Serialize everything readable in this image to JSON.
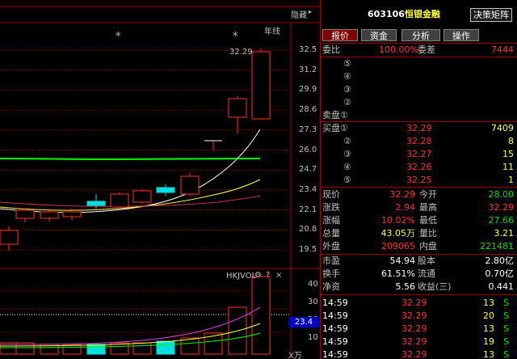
{
  "chart": {
    "hide_label": "隐藏",
    "period_label": "年线",
    "price_ticks": [
      "32.5",
      "31.2",
      "29.9",
      "28.6",
      "27.3",
      "26.0",
      "24.7",
      "23.4",
      "22.1",
      "20.8",
      "19.5"
    ],
    "high_label": "32.29",
    "star_marks": [
      "*",
      "*"
    ],
    "indicator_name": "HKJVOL",
    "indicator_tools": [
      "⚙",
      "?",
      "×"
    ],
    "vol_ticks": [
      "40",
      "30",
      "20",
      "10"
    ],
    "vol_current": "23.4",
    "vol_unit": "X万"
  },
  "header": {
    "code": "603106",
    "name": "恒银金融",
    "button": "决策矩阵"
  },
  "tabs": [
    "报价",
    "资金",
    "分析",
    "操作"
  ],
  "commission": {
    "ratio_label": "委比",
    "ratio_value": "100.00%",
    "diff_label": "委差",
    "diff_value": "7444"
  },
  "sell_levels": [
    {
      "label": "⑤",
      "price": "",
      "vol": ""
    },
    {
      "label": "④",
      "price": "",
      "vol": ""
    },
    {
      "label": "③",
      "price": "",
      "vol": ""
    },
    {
      "label": "②",
      "price": "",
      "vol": ""
    },
    {
      "label": "卖盘①",
      "price": "",
      "vol": ""
    }
  ],
  "buy_levels": [
    {
      "label": "买盘①",
      "price": "32.29",
      "vol": "7409"
    },
    {
      "label": "②",
      "price": "32.28",
      "vol": "8"
    },
    {
      "label": "③",
      "price": "32.27",
      "vol": "15"
    },
    {
      "label": "④",
      "price": "32.26",
      "vol": "11"
    },
    {
      "label": "⑤",
      "price": "32.25",
      "vol": "1"
    }
  ],
  "stats": [
    {
      "l1": "现价",
      "v1": "32.29",
      "l2": "今开",
      "v2": "28.00"
    },
    {
      "l1": "涨跌",
      "v1": "2.94",
      "l2": "最高",
      "v2": "32.29"
    },
    {
      "l1": "涨幅",
      "v1": "10.02%",
      "l2": "最低",
      "v2": "27.66"
    },
    {
      "l1": "总量",
      "v1": "43.05万",
      "l2": "量比",
      "v2": "3.21"
    },
    {
      "l1": "外盘",
      "v1": "209065",
      "l2": "内盘",
      "v2": "221481"
    }
  ],
  "fund": [
    {
      "l1": "市盈",
      "v1": "54.94",
      "l2": "股本",
      "v2": "2.80亿"
    },
    {
      "l1": "换手",
      "v1": "61.51%",
      "l2": "流通",
      "v2": "0.70亿"
    },
    {
      "l1": "净资",
      "v1": "5.56",
      "l2": "收益(三)",
      "v2": "0.441"
    }
  ],
  "ticks": [
    {
      "time": "14:59",
      "price": "32.29",
      "vol": "13",
      "dir": "S"
    },
    {
      "time": "14:59",
      "price": "32.29",
      "vol": "20",
      "dir": "S"
    },
    {
      "time": "14:59",
      "price": "32.29",
      "vol": "13",
      "dir": "S"
    },
    {
      "time": "14:59",
      "price": "32.29",
      "vol": "19",
      "dir": "S"
    },
    {
      "time": "14:59",
      "price": "32.29",
      "vol": "13",
      "dir": "S"
    }
  ],
  "colors": {
    "up": "#ff3030",
    "down": "#00e0e0",
    "grid": "#a00000",
    "ma1": "#ffffff",
    "ma2": "#ffff40",
    "ma3": "#c03060",
    "ma4": "#00ff00"
  }
}
